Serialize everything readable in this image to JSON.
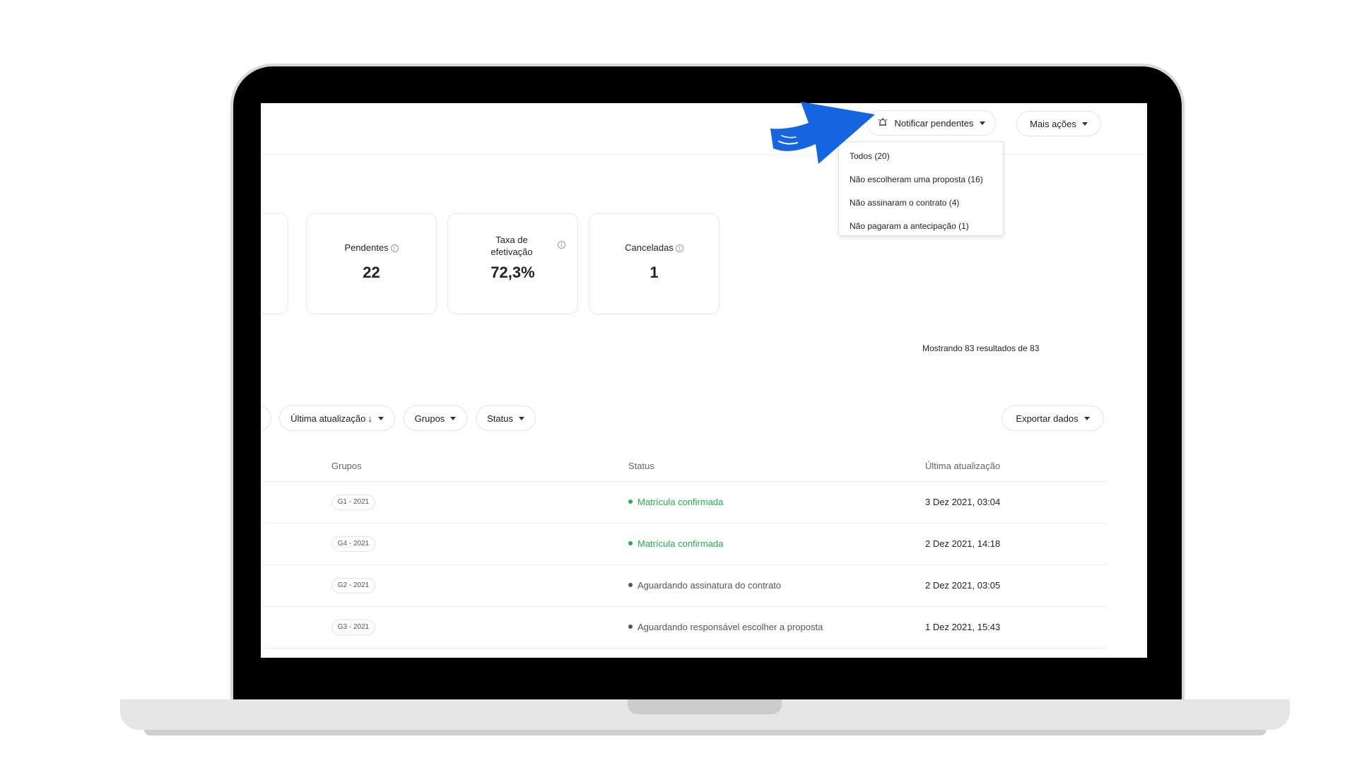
{
  "colors": {
    "confirmed": "#22b14c",
    "pending": "#555555",
    "arrow": "#1565e0"
  },
  "header": {
    "notify_button": {
      "icon": "bell-icon",
      "label": "Notificar pendentes"
    },
    "more_actions_label": "Mais ações"
  },
  "notify_menu": {
    "items": [
      "Todos (20)",
      "Não escolheram uma proposta (16)",
      "Não assinaram o contrato (4)",
      "Não pagaram a antecipação (1)"
    ]
  },
  "stats": {
    "pending": {
      "label": "Pendentes",
      "value": "22"
    },
    "rate": {
      "label_line1": "Taxa de",
      "label_line2": "efetivação",
      "value": "72,3%"
    },
    "cancelled": {
      "label": "Canceladas",
      "value": "1"
    }
  },
  "results": {
    "text": "Mostrando 83 resultados de 83"
  },
  "filters": {
    "last_update": "Última atualização",
    "groups": "Grupos",
    "status": "Status",
    "export": "Exportar dados"
  },
  "table": {
    "headers": {
      "groups": "Grupos",
      "status": "Status",
      "last_update": "Última atualização"
    },
    "rows": [
      {
        "group": "G1 - 2021",
        "status": "Matrícula confirmada",
        "state": "confirmed",
        "date": "3 Dez 2021, 03:04"
      },
      {
        "group": "G4 - 2021",
        "status": "Matrícula confirmada",
        "state": "confirmed",
        "date": "2 Dez 2021, 14:18"
      },
      {
        "group": "G2 - 2021",
        "status": "Aguardando assinatura do contrato",
        "state": "pending",
        "date": "2 Dez 2021, 03:05"
      },
      {
        "group": "G3 - 2021",
        "status": "Aguardando responsável escolher a proposta",
        "state": "pending",
        "date": "1 Dez 2021, 15:43"
      }
    ]
  }
}
